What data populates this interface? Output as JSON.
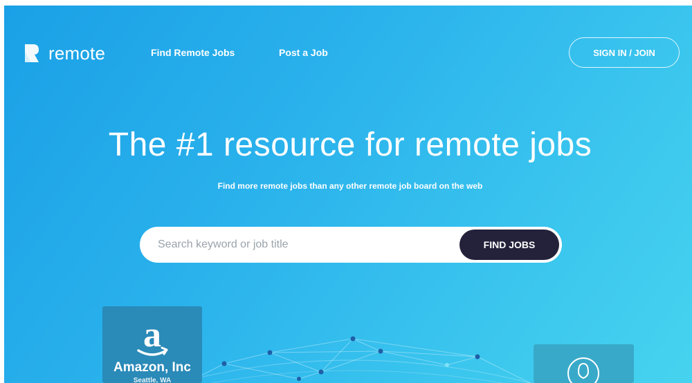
{
  "nav": {
    "logo_text": "remote",
    "links": [
      "Find Remote Jobs",
      "Post a Job"
    ],
    "signin_label": "SIGN IN / JOIN"
  },
  "hero": {
    "title": "The #1 resource for remote jobs",
    "subtitle": "Find more remote jobs than any other remote job board on the web"
  },
  "search": {
    "placeholder": "Search keyword or job title",
    "button_label": "FIND JOBS"
  },
  "cards": {
    "company": {
      "name": "Amazon, Inc",
      "location": "Seattle, WA",
      "icon": "amazon-logo-icon"
    },
    "profile": {
      "icon": "user-profile-icon"
    }
  },
  "colors": {
    "gradient_start": "#1aa0e6",
    "gradient_end": "#46d3ef",
    "button_dark": "#24213a"
  }
}
